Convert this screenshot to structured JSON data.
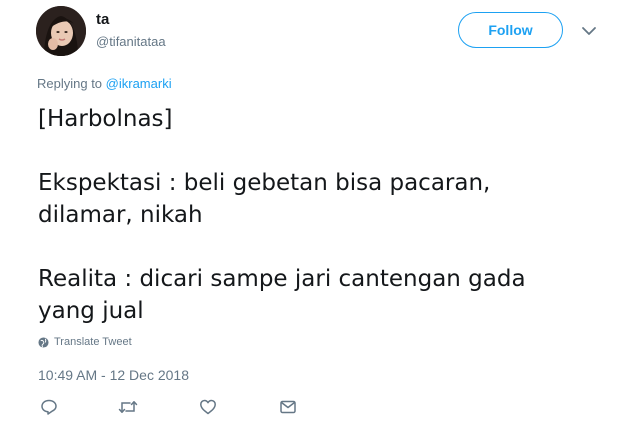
{
  "user": {
    "name": "ta",
    "handle": "@tifanitataa"
  },
  "follow_label": "Follow",
  "replying": {
    "prefix": "Replying to ",
    "target": "@ikramarki"
  },
  "tweet_lines": [
    "[Harbolnas]",
    "",
    "Ekspektasi : beli gebetan bisa pacaran,",
    "dilamar, nikah",
    "",
    "Realita : dicari sampe jari cantengan gada",
    "yang jual"
  ],
  "translate_label": "Translate Tweet",
  "timestamp": "10:49 AM - 12 Dec 2018",
  "icons": {
    "reply": "reply-icon",
    "retweet": "retweet-icon",
    "like": "heart-icon",
    "dm": "envelope-icon",
    "caret": "chevron-down-icon",
    "globe": "globe-icon"
  },
  "colors": {
    "accent": "#1da1f2",
    "muted": "#657786",
    "text": "#14171a"
  }
}
